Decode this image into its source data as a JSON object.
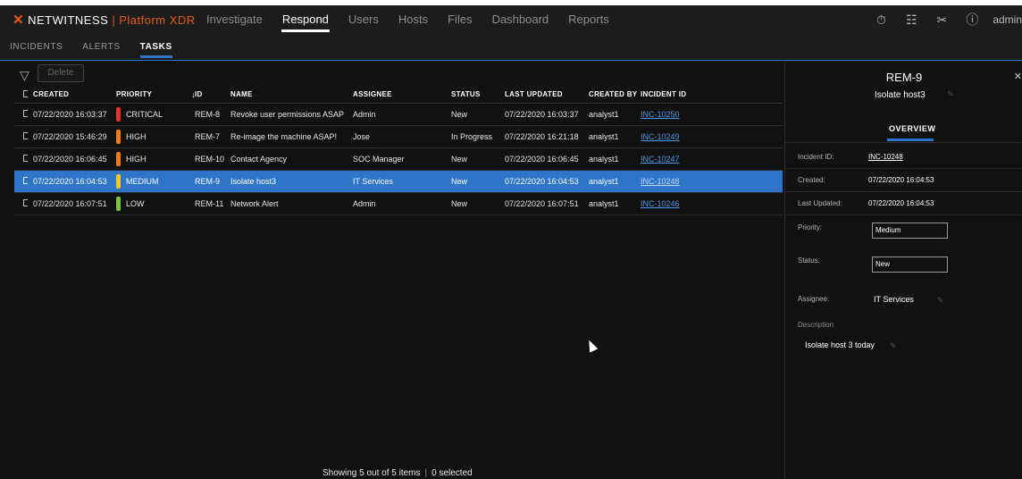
{
  "brand": {
    "icon": "netwitness-x-logo-icon",
    "name": "NETWITNESS",
    "separator": "|",
    "product": "Platform XDR"
  },
  "nav": [
    {
      "label": "Investigate",
      "active": false
    },
    {
      "label": "Respond",
      "active": true
    },
    {
      "label": "Users",
      "active": false
    },
    {
      "label": "Hosts",
      "active": false
    },
    {
      "label": "Files",
      "active": false
    },
    {
      "label": "Dashboard",
      "active": false
    },
    {
      "label": "Reports",
      "active": false
    }
  ],
  "top_icons": [
    "stopwatch-icon",
    "settings-panel-icon",
    "tools-icon",
    "help-icon"
  ],
  "user": "admin",
  "subtabs": [
    {
      "label": "INCIDENTS",
      "active": false
    },
    {
      "label": "ALERTS",
      "active": false
    },
    {
      "label": "TASKS",
      "active": true
    }
  ],
  "toolbar": {
    "delete_label": "Delete"
  },
  "columns": {
    "created": "CREATED",
    "priority": "PRIORITY",
    "id": "ID",
    "name": "NAME",
    "assignee": "ASSIGNEE",
    "status": "STATUS",
    "last_updated": "LAST UPDATED",
    "created_by": "CREATED BY",
    "incident_id": "INCIDENT ID",
    "sort_indicator": "↓"
  },
  "rows": [
    {
      "created": "07/22/2020 16:03:37",
      "priority": "CRITICAL",
      "id": "REM-8",
      "name": "Revoke user permissions ASAP",
      "assignee": "Admin",
      "status": "New",
      "last_updated": "07/22/2020 16:03:37",
      "created_by": "analyst1",
      "incident_id": "INC-10250"
    },
    {
      "created": "07/22/2020 15:46:29",
      "priority": "HIGH",
      "id": "REM-7",
      "name": "Re-image the machine ASAP!",
      "assignee": "Jose",
      "status": "In Progress",
      "last_updated": "07/22/2020 16:21:18",
      "created_by": "analyst1",
      "incident_id": "INC-10249"
    },
    {
      "created": "07/22/2020 16:06:45",
      "priority": "HIGH",
      "id": "REM-10",
      "name": "Contact Agency",
      "assignee": "SOC Manager",
      "status": "New",
      "last_updated": "07/22/2020 16:06:45",
      "created_by": "analyst1",
      "incident_id": "INC-10247"
    },
    {
      "created": "07/22/2020 16:04:53",
      "priority": "MEDIUM",
      "id": "REM-9",
      "name": "Isolate host3",
      "assignee": "IT Services",
      "status": "New",
      "last_updated": "07/22/2020 16:04:53",
      "created_by": "analyst1",
      "incident_id": "INC-10248",
      "selected": true
    },
    {
      "created": "07/22/2020 16:07:51",
      "priority": "LOW",
      "id": "REM-11",
      "name": "Network Alert",
      "assignee": "Admin",
      "status": "New",
      "last_updated": "07/22/2020 16:07:51",
      "created_by": "analyst1",
      "incident_id": "INC-10246"
    }
  ],
  "priority_colors": {
    "CRITICAL": "#e5332a",
    "HIGH": "#f07d1a",
    "MEDIUM": "#f2c81e",
    "LOW": "#7cc242"
  },
  "footer": {
    "showing": "Showing 5 out of 5 items",
    "selected": "0 selected"
  },
  "panel": {
    "title": "REM-9",
    "name": "Isolate host3",
    "close_icon": "close-icon",
    "tab": "OVERVIEW",
    "incident_id_label": "Incident ID:",
    "incident_id": "INC-10248",
    "created_label": "Created:",
    "created": "07/22/2020 16:04:53",
    "last_updated_label": "Last Updated:",
    "last_updated": "07/22/2020 16:04:53",
    "priority_label": "Priority:",
    "priority": "Medium",
    "status_label": "Status:",
    "status": "New",
    "assignee_label": "Assignee:",
    "assignee": "IT Services",
    "description_label": "Description",
    "description": "Isolate host 3 today"
  },
  "colors": {
    "accent": "#2a73c9",
    "selected_row": "#2e74c9",
    "brand": "#e85d1a",
    "link": "#4a9bea"
  }
}
